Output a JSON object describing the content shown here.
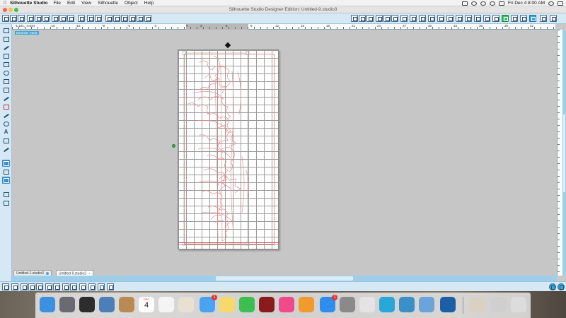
{
  "menubar": {
    "app_name": "Silhouette Studio",
    "items": [
      "File",
      "Edit",
      "View",
      "Silhouette",
      "Object",
      "Help"
    ],
    "clock": "Fri Dec 4  8:00 AM"
  },
  "window": {
    "title": "Silhouette Studio Designer Edition: Untitled-9.studio3"
  },
  "ruler": {
    "top_labels": [
      "-15",
      "-12",
      "-9",
      "-6",
      "-3",
      "0",
      "3",
      "6",
      "9",
      "12",
      "15",
      "18",
      "21",
      "24",
      "27",
      "30",
      "33",
      "36",
      "39",
      "42"
    ],
    "readout": "-1.101, -4.644"
  },
  "workspace": {
    "view_tag": "DESIGN VIEW"
  },
  "tabs": [
    {
      "label": "Untitled-1.studio3",
      "active": false
    },
    {
      "label": "Untitled-9.studio3",
      "active": true
    }
  ],
  "dock": {
    "calendar_month": "DEC",
    "calendar_day": "4",
    "messages_badge": "1",
    "appstore_badge": "1",
    "apps": [
      {
        "name": "finder-icon",
        "color": "#3d8fe0"
      },
      {
        "name": "launchpad-icon",
        "color": "#6a6a72"
      },
      {
        "name": "media-icon",
        "color": "#2d2d2d"
      },
      {
        "name": "preview-icon",
        "color": "#4c7fb8"
      },
      {
        "name": "contacts-icon",
        "color": "#b88a54"
      },
      {
        "name": "calendar-icon",
        "color": "#ffffff"
      },
      {
        "name": "reminders-icon",
        "color": "#f4f4f4"
      },
      {
        "name": "photos-icon",
        "color": "#e8e0d0"
      },
      {
        "name": "messages-icon",
        "color": "#4aa3f0"
      },
      {
        "name": "notes-icon",
        "color": "#f7d86a"
      },
      {
        "name": "facetime-icon",
        "color": "#3dbd52"
      },
      {
        "name": "photobooth-icon",
        "color": "#8a1b1b"
      },
      {
        "name": "itunes-icon",
        "color": "#f04a8a"
      },
      {
        "name": "ibooks-icon",
        "color": "#f29a2e"
      },
      {
        "name": "appstore-icon",
        "color": "#2f8df0"
      },
      {
        "name": "system-preferences-icon",
        "color": "#8a8a8a"
      },
      {
        "name": "chrome-icon",
        "color": "#e4e4e4"
      },
      {
        "name": "silhouette-studio-icon",
        "color": "#29a7d8"
      },
      {
        "name": "island-photo-icon",
        "color": "#3b8fc9"
      },
      {
        "name": "image-capture-icon",
        "color": "#6aa4d8"
      },
      {
        "name": "silhouette-connect-icon",
        "color": "#1d5fa6"
      },
      {
        "name": "document-icon",
        "color": "#d9d2c2"
      },
      {
        "name": "files-icon",
        "color": "#cfcfcf"
      },
      {
        "name": "trash-icon",
        "color": "#dcdcdc"
      }
    ]
  }
}
